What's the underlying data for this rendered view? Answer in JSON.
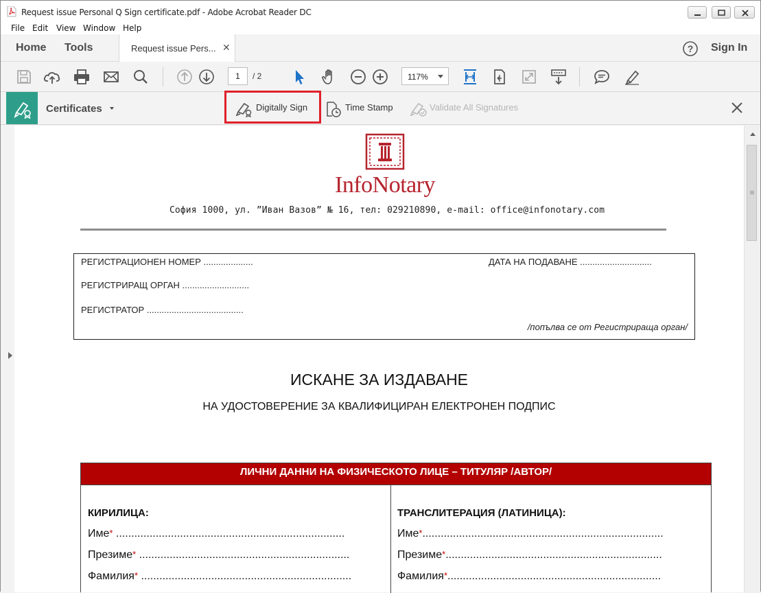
{
  "window": {
    "title": "Request issue Personal Q Sign certificate.pdf - Adobe Acrobat Reader DC"
  },
  "menu": [
    "File",
    "Edit",
    "View",
    "Window",
    "Help"
  ],
  "tabs": {
    "home": "Home",
    "tools": "Tools",
    "document": "Request issue Pers...",
    "sign_in": "Sign In"
  },
  "toolbar": {
    "current_page": "1",
    "total_pages": "/ 2",
    "zoom": "117%"
  },
  "certificates_bar": {
    "label": "Certificates",
    "digitally_sign": "Digitally Sign",
    "time_stamp": "Time Stamp",
    "validate_all": "Validate All Signatures"
  },
  "document": {
    "logo_text": "InfoNotary",
    "address": "София 1000, ул. ”Иван Вазов” № 16, тел: 029210890, e-mail: office@infonotary.com",
    "registration": {
      "number": "РЕГИСТРАЦИОНЕН НОМЕР ....................",
      "date": "ДАТА НА ПОДАВАНЕ .............................",
      "authority": "РЕГИСТРИРАЩ ОРГАН ...........................",
      "registrar": "РЕГИСТРАТОР .......................................",
      "note": "/попълва се от Регистрираща орган/"
    },
    "title": "ИСКАНЕ ЗА ИЗДАВАНЕ",
    "subtitle": "НА УДОСТОВЕРЕНИЕ ЗА КВАЛИФИЦИРАН ЕЛЕКТРОНЕН ПОДПИС",
    "personal_data": {
      "header": "ЛИЧНИ ДАННИ НА ФИЗИЧЕСКОТО ЛИЦЕ – ТИТУЛЯР /АВТОР/",
      "left_heading": "КИРИЛИЦА:",
      "right_heading": "ТРАНСЛИТЕРАЦИЯ (ЛАТИНИЦА):",
      "left_fields": [
        {
          "label": "Име",
          "dots": " ..........................................................................."
        },
        {
          "label": "Презиме",
          "dots": " ....................................................................."
        },
        {
          "label": "Фамилия",
          "dots": " ....................................................................."
        }
      ],
      "right_fields": [
        {
          "label": "Име",
          "dots": "..............................................................................."
        },
        {
          "label": "Презиме",
          "dots": "......................................................................."
        },
        {
          "label": "Фамилия",
          "dots": "......................................................................"
        }
      ],
      "required_mark": "*"
    }
  },
  "colors": {
    "cert_tile": "#2e9e8a",
    "highlight": "#e0202a",
    "logo": "#b6242e",
    "table_header": "#b30000",
    "select_tool": "#1f73c9"
  }
}
